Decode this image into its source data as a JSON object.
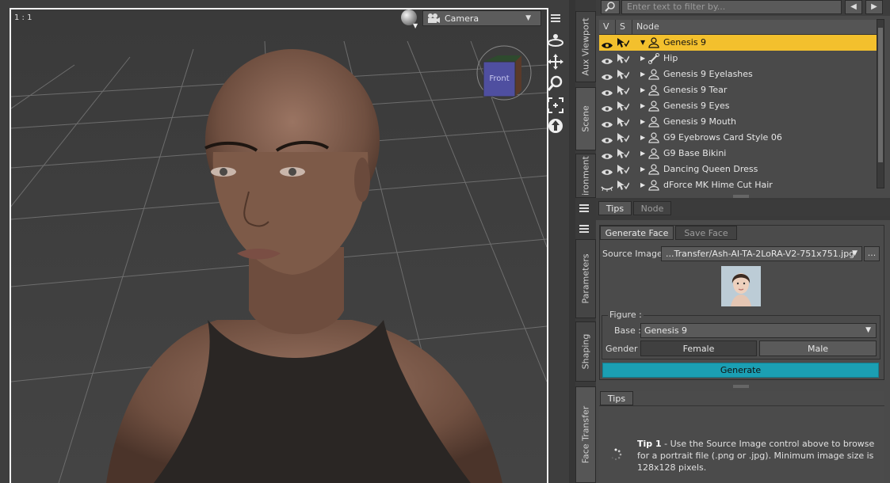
{
  "viewport": {
    "label": "1 : 1",
    "camera_label": "Camera",
    "cube_label": "Front"
  },
  "side_tabs": {
    "aux_viewport": "Aux Viewport",
    "scene": "Scene",
    "environment": "ironment",
    "parameters": "Parameters",
    "shaping": "Shaping",
    "face_transfer": "Face Transfer"
  },
  "scene": {
    "filter_placeholder": "Enter text to filter by...",
    "header": {
      "v": "V",
      "s": "S",
      "node": "Node"
    },
    "nodes": [
      {
        "name": "Genesis 9",
        "selected": true,
        "expanded": true,
        "icon": "figure-icon"
      },
      {
        "name": "Hip",
        "icon": "bone-icon"
      },
      {
        "name": "Genesis 9 Eyelashes",
        "icon": "figure-icon"
      },
      {
        "name": "Genesis 9 Tear",
        "icon": "figure-icon"
      },
      {
        "name": "Genesis 9 Eyes",
        "icon": "figure-icon"
      },
      {
        "name": "Genesis 9 Mouth",
        "icon": "figure-icon"
      },
      {
        "name": "G9 Eyebrows Card Style 06",
        "icon": "figure-icon"
      },
      {
        "name": "G9 Base Bikini",
        "icon": "figure-icon"
      },
      {
        "name": "Dancing Queen Dress",
        "icon": "figure-icon"
      },
      {
        "name": "dForce MK Hime Cut Hair",
        "icon": "figure-icon",
        "hidden": true
      }
    ]
  },
  "tabs_tips_node": {
    "tips": "Tips",
    "node": "Node"
  },
  "face_transfer": {
    "tab_generate": "Generate Face",
    "tab_save": "Save Face",
    "source_label": "Source Image :",
    "source_value": "...Transfer/Ash-AI-TA-2LoRA-V2-751x751.jpg",
    "browse_label": "...",
    "figure_legend": "Figure :",
    "base_label": "Base :",
    "base_value": "Genesis 9",
    "gender_label": "Gender :",
    "female_label": "Female",
    "male_label": "Male",
    "generate_label": "Generate",
    "tips_tab": "Tips",
    "tip_title": "Tip 1",
    "tip_body": " - Use the Source Image control above to browse for a portrait file (.png or .jpg). Minimum image size is 128x128 pixels."
  },
  "colors": {
    "selected_row": "#f3c02d",
    "generate_button": "#1b9fb3"
  }
}
